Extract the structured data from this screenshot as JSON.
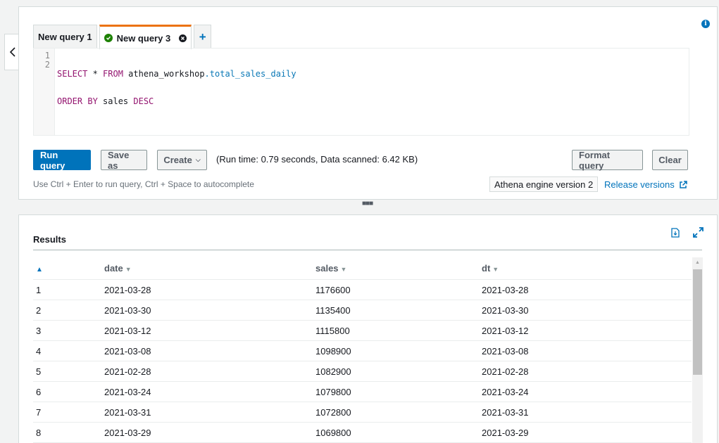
{
  "tabs": [
    {
      "label": "New query 1",
      "active": false
    },
    {
      "label": "New query 3",
      "active": true
    }
  ],
  "editor": {
    "line_numbers": [
      "1",
      "2"
    ],
    "line1": {
      "k1": "SELECT",
      "t1": " * ",
      "k2": "FROM",
      "t2": " athena_workshop",
      "t3": ".total_sales_daily"
    },
    "line2": {
      "k1": "ORDER BY",
      "t1": " sales ",
      "k2": "DESC"
    }
  },
  "toolbar": {
    "run_label": "Run query",
    "save_label": "Save as",
    "create_label": "Create",
    "run_info": "(Run time: 0.79 seconds, Data scanned: 6.42 KB)",
    "format_label": "Format query",
    "clear_label": "Clear",
    "hint": "Use Ctrl + Enter to run query, Ctrl + Space to autocomplete",
    "engine_label": "Athena engine version 2",
    "release_label": "Release versions"
  },
  "results": {
    "title": "Results",
    "columns": [
      "date",
      "sales",
      "dt"
    ],
    "rows": [
      [
        "1",
        "2021-03-28",
        "1176600",
        "2021-03-28"
      ],
      [
        "2",
        "2021-03-30",
        "1135400",
        "2021-03-30"
      ],
      [
        "3",
        "2021-03-12",
        "1115800",
        "2021-03-12"
      ],
      [
        "4",
        "2021-03-08",
        "1098900",
        "2021-03-08"
      ],
      [
        "5",
        "2021-02-28",
        "1082900",
        "2021-02-28"
      ],
      [
        "6",
        "2021-03-24",
        "1079800",
        "2021-03-24"
      ],
      [
        "7",
        "2021-03-31",
        "1072800",
        "2021-03-31"
      ],
      [
        "8",
        "2021-03-29",
        "1069800",
        "2021-03-29"
      ]
    ]
  },
  "colors": {
    "primary": "#0073bb",
    "active_tab_accent": "#ec7211",
    "success": "#1d8102"
  }
}
